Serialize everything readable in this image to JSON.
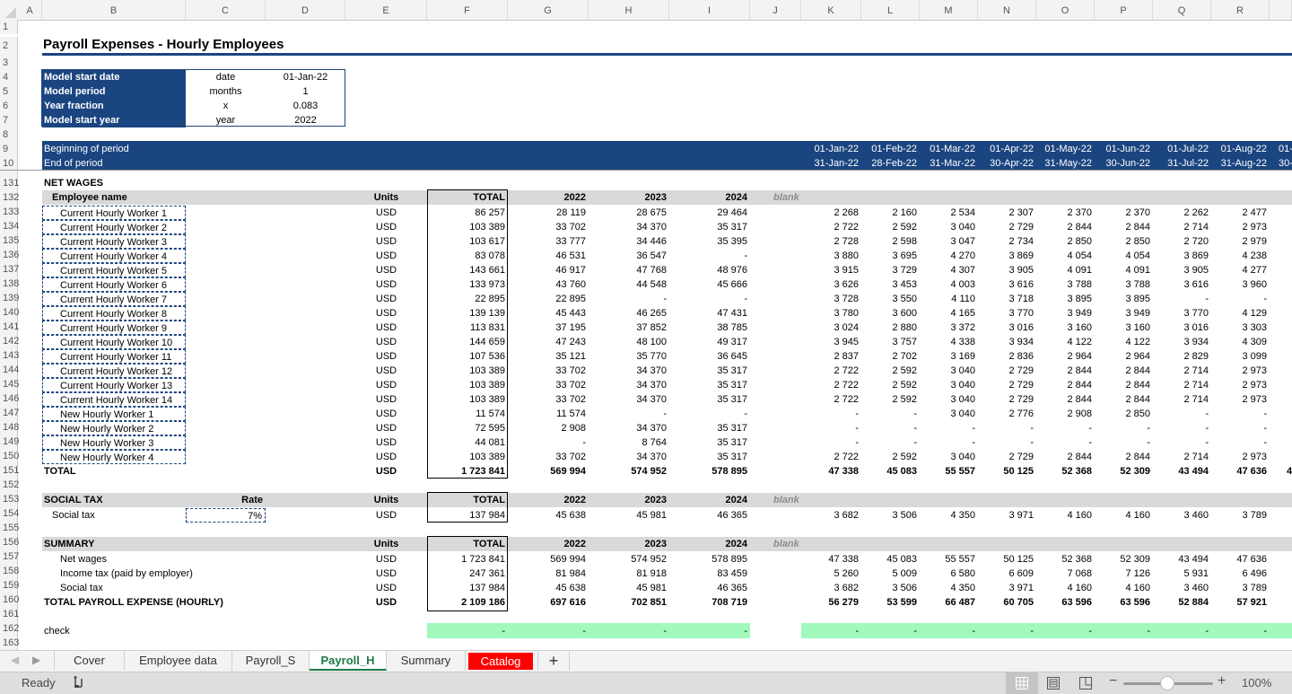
{
  "columns": [
    "A",
    "B",
    "C",
    "D",
    "E",
    "F",
    "G",
    "H",
    "I",
    "J",
    "K",
    "L",
    "M",
    "N",
    "O",
    "P",
    "Q",
    "R"
  ],
  "rows_top": [
    "1",
    "2",
    "3",
    "4",
    "5",
    "6",
    "7",
    "8",
    "9",
    "10"
  ],
  "title": "Payroll Expenses - Hourly Employees",
  "settings": [
    {
      "label": "Model start date",
      "unit": "date",
      "value": "01-Jan-22"
    },
    {
      "label": "Model period",
      "unit": "months",
      "value": "1"
    },
    {
      "label": "Year fraction",
      "unit": "x",
      "value": "0.083"
    },
    {
      "label": "Model start year",
      "unit": "year",
      "value": "2022"
    }
  ],
  "period_header": {
    "begin_label": "Beginning of period",
    "end_label": "End of period",
    "begin_dates": [
      "01-Jan-22",
      "01-Feb-22",
      "01-Mar-22",
      "01-Apr-22",
      "01-May-22",
      "01-Jun-22",
      "01-Jul-22",
      "01-Aug-22",
      "01-"
    ],
    "end_dates": [
      "31-Jan-22",
      "28-Feb-22",
      "31-Mar-22",
      "30-Apr-22",
      "31-May-22",
      "30-Jun-22",
      "31-Jul-22",
      "31-Aug-22",
      "30-"
    ]
  },
  "net_wages": {
    "section_title": "NET WAGES",
    "header": {
      "name": "Employee name",
      "units": "Units",
      "total": "TOTAL",
      "y1": "2022",
      "y2": "2023",
      "y3": "2024",
      "blank": "blank"
    },
    "rows": [
      {
        "row": "133",
        "name": "Current Hourly Worker 1",
        "units": "USD",
        "total": "86 257",
        "y": [
          "28 119",
          "28 675",
          "29 464"
        ],
        "m": [
          "2 268",
          "2 160",
          "2 534",
          "2 307",
          "2 370",
          "2 370",
          "2 262",
          "2 477"
        ]
      },
      {
        "row": "134",
        "name": "Current Hourly Worker 2",
        "units": "USD",
        "total": "103 389",
        "y": [
          "33 702",
          "34 370",
          "35 317"
        ],
        "m": [
          "2 722",
          "2 592",
          "3 040",
          "2 729",
          "2 844",
          "2 844",
          "2 714",
          "2 973"
        ]
      },
      {
        "row": "135",
        "name": "Current Hourly Worker 3",
        "units": "USD",
        "total": "103 617",
        "y": [
          "33 777",
          "34 446",
          "35 395"
        ],
        "m": [
          "2 728",
          "2 598",
          "3 047",
          "2 734",
          "2 850",
          "2 850",
          "2 720",
          "2 979"
        ]
      },
      {
        "row": "136",
        "name": "Current Hourly Worker 4",
        "units": "USD",
        "total": "83 078",
        "y": [
          "46 531",
          "36 547",
          "-"
        ],
        "m": [
          "3 880",
          "3 695",
          "4 270",
          "3 869",
          "4 054",
          "4 054",
          "3 869",
          "4 238"
        ]
      },
      {
        "row": "137",
        "name": "Current Hourly Worker 5",
        "units": "USD",
        "total": "143 661",
        "y": [
          "46 917",
          "47 768",
          "48 976"
        ],
        "m": [
          "3 915",
          "3 729",
          "4 307",
          "3 905",
          "4 091",
          "4 091",
          "3 905",
          "4 277"
        ]
      },
      {
        "row": "138",
        "name": "Current Hourly Worker 6",
        "units": "USD",
        "total": "133 973",
        "y": [
          "43 760",
          "44 548",
          "45 666"
        ],
        "m": [
          "3 626",
          "3 453",
          "4 003",
          "3 616",
          "3 788",
          "3 788",
          "3 616",
          "3 960"
        ]
      },
      {
        "row": "139",
        "name": "Current Hourly Worker 7",
        "units": "USD",
        "total": "22 895",
        "y": [
          "22 895",
          "-",
          "-"
        ],
        "m": [
          "3 728",
          "3 550",
          "4 110",
          "3 718",
          "3 895",
          "3 895",
          "-",
          "-"
        ]
      },
      {
        "row": "140",
        "name": "Current Hourly Worker 8",
        "units": "USD",
        "total": "139 139",
        "y": [
          "45 443",
          "46 265",
          "47 431"
        ],
        "m": [
          "3 780",
          "3 600",
          "4 165",
          "3 770",
          "3 949",
          "3 949",
          "3 770",
          "4 129"
        ]
      },
      {
        "row": "141",
        "name": "Current Hourly Worker 9",
        "units": "USD",
        "total": "113 831",
        "y": [
          "37 195",
          "37 852",
          "38 785"
        ],
        "m": [
          "3 024",
          "2 880",
          "3 372",
          "3 016",
          "3 160",
          "3 160",
          "3 016",
          "3 303"
        ]
      },
      {
        "row": "142",
        "name": "Current Hourly Worker 10",
        "units": "USD",
        "total": "144 659",
        "y": [
          "47 243",
          "48 100",
          "49 317"
        ],
        "m": [
          "3 945",
          "3 757",
          "4 338",
          "3 934",
          "4 122",
          "4 122",
          "3 934",
          "4 309"
        ]
      },
      {
        "row": "143",
        "name": "Current Hourly Worker 11",
        "units": "USD",
        "total": "107 536",
        "y": [
          "35 121",
          "35 770",
          "36 645"
        ],
        "m": [
          "2 837",
          "2 702",
          "3 169",
          "2 836",
          "2 964",
          "2 964",
          "2 829",
          "3 099"
        ]
      },
      {
        "row": "144",
        "name": "Current Hourly Worker 12",
        "units": "USD",
        "total": "103 389",
        "y": [
          "33 702",
          "34 370",
          "35 317"
        ],
        "m": [
          "2 722",
          "2 592",
          "3 040",
          "2 729",
          "2 844",
          "2 844",
          "2 714",
          "2 973"
        ]
      },
      {
        "row": "145",
        "name": "Current Hourly Worker 13",
        "units": "USD",
        "total": "103 389",
        "y": [
          "33 702",
          "34 370",
          "35 317"
        ],
        "m": [
          "2 722",
          "2 592",
          "3 040",
          "2 729",
          "2 844",
          "2 844",
          "2 714",
          "2 973"
        ]
      },
      {
        "row": "146",
        "name": "Current Hourly Worker 14",
        "units": "USD",
        "total": "103 389",
        "y": [
          "33 702",
          "34 370",
          "35 317"
        ],
        "m": [
          "2 722",
          "2 592",
          "3 040",
          "2 729",
          "2 844",
          "2 844",
          "2 714",
          "2 973"
        ]
      },
      {
        "row": "147",
        "name": "New Hourly Worker 1",
        "units": "USD",
        "total": "11 574",
        "y": [
          "11 574",
          "-",
          "-"
        ],
        "m": [
          "-",
          "-",
          "3 040",
          "2 776",
          "2 908",
          "2 850",
          "-",
          "-"
        ]
      },
      {
        "row": "148",
        "name": "New Hourly Worker 2",
        "units": "USD",
        "total": "72 595",
        "y": [
          "2 908",
          "34 370",
          "35 317"
        ],
        "m": [
          "-",
          "-",
          "-",
          "-",
          "-",
          "-",
          "-",
          "-"
        ]
      },
      {
        "row": "149",
        "name": "New Hourly Worker 3",
        "units": "USD",
        "total": "44 081",
        "y": [
          "-",
          "8 764",
          "35 317"
        ],
        "m": [
          "-",
          "-",
          "-",
          "-",
          "-",
          "-",
          "-",
          "-"
        ]
      },
      {
        "row": "150",
        "name": "New Hourly Worker 4",
        "units": "USD",
        "total": "103 389",
        "y": [
          "33 702",
          "34 370",
          "35 317"
        ],
        "m": [
          "2 722",
          "2 592",
          "3 040",
          "2 729",
          "2 844",
          "2 844",
          "2 714",
          "2 973"
        ]
      }
    ],
    "total": {
      "row": "151",
      "name": "TOTAL",
      "units": "USD",
      "total": "1 723 841",
      "y": [
        "569 994",
        "574 952",
        "578 895"
      ],
      "m": [
        "47 338",
        "45 083",
        "55 557",
        "50 125",
        "52 368",
        "52 309",
        "43 494",
        "47 636"
      ]
    }
  },
  "social_tax": {
    "section_title": "SOCIAL TAX",
    "rate_label": "Rate",
    "units_label": "Units",
    "total_label": "TOTAL",
    "y_labels": [
      "2022",
      "2023",
      "2024"
    ],
    "blank": "blank",
    "row": {
      "name": "Social tax",
      "rate": "7%",
      "units": "USD",
      "total": "137 984",
      "y": [
        "45 638",
        "45 981",
        "46 365"
      ],
      "m": [
        "3 682",
        "3 506",
        "4 350",
        "3 971",
        "4 160",
        "4 160",
        "3 460",
        "3 789"
      ]
    }
  },
  "summary": {
    "section_title": "SUMMARY",
    "units_label": "Units",
    "total_label": "TOTAL",
    "y_labels": [
      "2022",
      "2023",
      "2024"
    ],
    "blank": "blank",
    "rows": [
      {
        "row": "157",
        "name": "Net wages",
        "units": "USD",
        "total": "1 723 841",
        "y": [
          "569 994",
          "574 952",
          "578 895"
        ],
        "m": [
          "47 338",
          "45 083",
          "55 557",
          "50 125",
          "52 368",
          "52 309",
          "43 494",
          "47 636"
        ]
      },
      {
        "row": "158",
        "name": "Income tax (paid by employer)",
        "units": "USD",
        "total": "247 361",
        "y": [
          "81 984",
          "81 918",
          "83 459"
        ],
        "m": [
          "5 260",
          "5 009",
          "6 580",
          "6 609",
          "7 068",
          "7 126",
          "5 931",
          "6 496"
        ]
      },
      {
        "row": "159",
        "name": "Social tax",
        "units": "USD",
        "total": "137 984",
        "y": [
          "45 638",
          "45 981",
          "46 365"
        ],
        "m": [
          "3 682",
          "3 506",
          "4 350",
          "3 971",
          "4 160",
          "4 160",
          "3 460",
          "3 789"
        ]
      }
    ],
    "total": {
      "row": "160",
      "name": "TOTAL PAYROLL EXPENSE (HOURLY)",
      "units": "USD",
      "total": "2 109 186",
      "y": [
        "697 616",
        "702 851",
        "708 719"
      ],
      "m": [
        "56 279",
        "53 599",
        "66 487",
        "60 705",
        "63 596",
        "63 596",
        "52 884",
        "57 921"
      ]
    }
  },
  "check": {
    "label": "check",
    "total": "-",
    "y": [
      "-",
      "-",
      "-"
    ],
    "m": [
      "-",
      "-",
      "-",
      "-",
      "-",
      "-",
      "-",
      "-"
    ]
  },
  "row_numbers_bottom": [
    "131",
    "132",
    "133",
    "134",
    "135",
    "136",
    "137",
    "138",
    "139",
    "140",
    "141",
    "142",
    "143",
    "144",
    "145",
    "146",
    "147",
    "148",
    "149",
    "150",
    "151",
    "152",
    "153",
    "154",
    "155",
    "156",
    "157",
    "158",
    "159",
    "160",
    "161",
    "162",
    "163"
  ],
  "sheet_tabs": [
    {
      "label": "Cover",
      "state": "normal"
    },
    {
      "label": "Employee data",
      "state": "normal"
    },
    {
      "label": "Payroll_S",
      "state": "normal"
    },
    {
      "label": "Payroll_H",
      "state": "active"
    },
    {
      "label": "Summary",
      "state": "normal"
    },
    {
      "label": "Catalog",
      "state": "red"
    }
  ],
  "add_sheet": "+",
  "status": {
    "ready": "Ready",
    "zoom": "100%",
    "zoom_level_percent": 100
  },
  "colors": {
    "navy": "#1b4580",
    "header_grey": "#d9d9d9",
    "check_green": "#a2f8bd",
    "active_tab": "#1d7a45",
    "catalog_tab": "#ff0000"
  }
}
